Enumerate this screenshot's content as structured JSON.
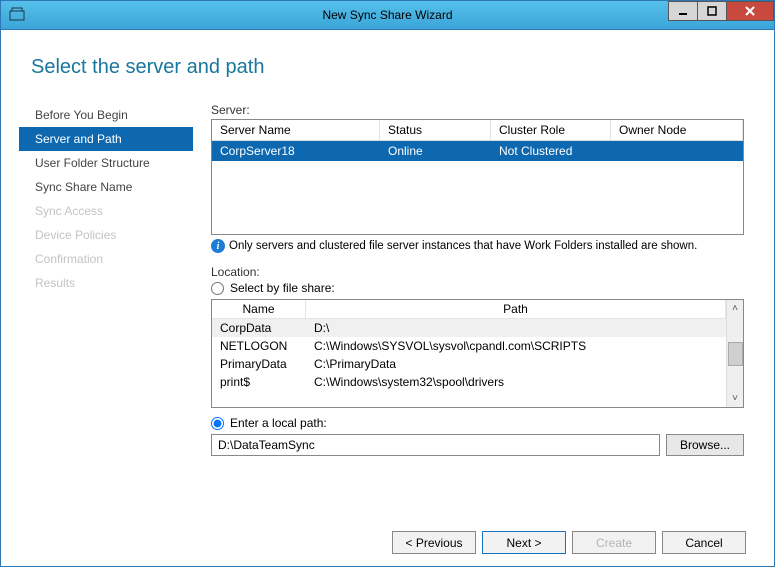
{
  "window": {
    "title": "New Sync Share Wizard"
  },
  "page": {
    "heading": "Select the server and path"
  },
  "nav": {
    "items": [
      {
        "label": "Before You Begin",
        "state": "normal"
      },
      {
        "label": "Server and Path",
        "state": "selected"
      },
      {
        "label": "User Folder Structure",
        "state": "normal"
      },
      {
        "label": "Sync Share Name",
        "state": "normal"
      },
      {
        "label": "Sync Access",
        "state": "disabled"
      },
      {
        "label": "Device Policies",
        "state": "disabled"
      },
      {
        "label": "Confirmation",
        "state": "disabled"
      },
      {
        "label": "Results",
        "state": "disabled"
      }
    ]
  },
  "server_section": {
    "label": "Server:",
    "columns": {
      "name": "Server Name",
      "status": "Status",
      "cluster": "Cluster Role",
      "owner": "Owner Node"
    },
    "rows": [
      {
        "name": "CorpServer18",
        "status": "Online",
        "cluster": "Not Clustered",
        "owner": ""
      }
    ],
    "info": "Only servers and clustered file server instances that have Work Folders installed are shown."
  },
  "location_section": {
    "label": "Location:",
    "option_share": "Select by file share:",
    "option_local": "Enter a local path:",
    "share_columns": {
      "name": "Name",
      "path": "Path"
    },
    "shares": [
      {
        "name": "CorpData",
        "path": "D:\\"
      },
      {
        "name": "NETLOGON",
        "path": "C:\\Windows\\SYSVOL\\sysvol\\cpandl.com\\SCRIPTS"
      },
      {
        "name": "PrimaryData",
        "path": "C:\\PrimaryData"
      },
      {
        "name": "print$",
        "path": "C:\\Windows\\system32\\spool\\drivers"
      }
    ],
    "local_path_value": "D:\\DataTeamSync",
    "browse_label": "Browse..."
  },
  "footer": {
    "previous": "< Previous",
    "next": "Next >",
    "create": "Create",
    "cancel": "Cancel"
  }
}
